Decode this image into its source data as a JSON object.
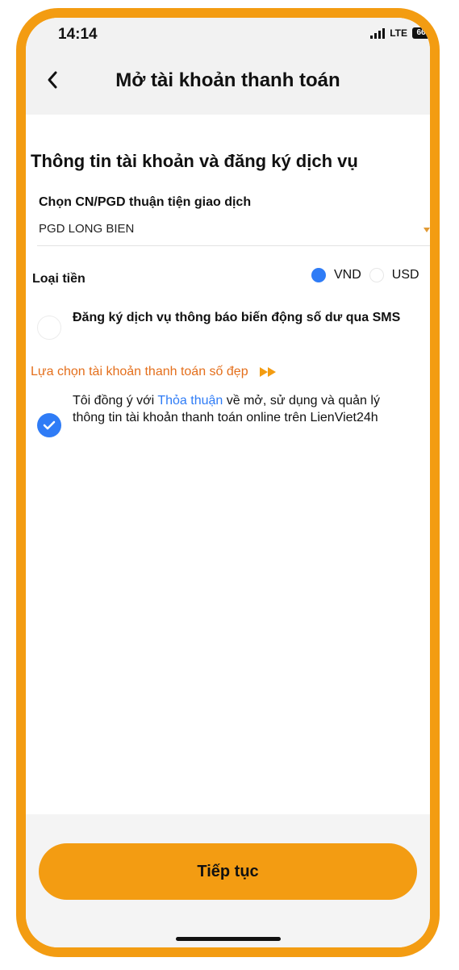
{
  "status_bar": {
    "time": "14:14",
    "network": "LTE",
    "battery": "66"
  },
  "header": {
    "title": "Mở tài khoản thanh toán",
    "back_icon": "chevron-left-icon"
  },
  "form": {
    "section_title": "Thông tin tài khoản và đăng ký dịch vụ",
    "branch": {
      "label": "Chọn CN/PGD thuận tiện giao dịch",
      "value": "PGD LONG BIEN",
      "arrow_icon": "dropdown-arrow-icon"
    },
    "currency": {
      "label": "Loại tiền",
      "options": [
        {
          "label": "VND",
          "selected": true
        },
        {
          "label": "USD",
          "selected": false
        }
      ]
    },
    "sms": {
      "text": "Đăng ký dịch vụ thông báo biến động số dư qua SMS",
      "checked": false
    },
    "beauty_account": {
      "text": "Lựa chọn tài khoản thanh toán số đẹp",
      "icon": "fast-forward-icon"
    },
    "agreement": {
      "prefix": "Tôi đồng ý với ",
      "link": "Thỏa thuận",
      "suffix": " về mở, sử dụng và quản lý thông tin tài khoản thanh toán online trên LienViet24h",
      "checked": true
    }
  },
  "footer": {
    "next_label": "Tiếp tục"
  },
  "colors": {
    "accent": "#F39C12",
    "primary": "#2F7CF6",
    "highlight_text": "#E46F1C"
  }
}
